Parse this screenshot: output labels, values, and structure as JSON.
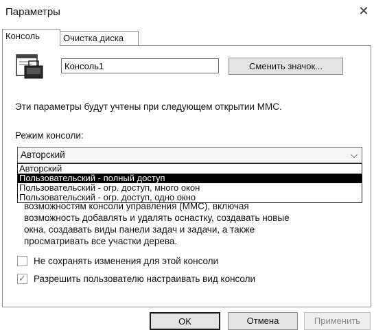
{
  "window": {
    "title": "Параметры",
    "close_glyph": "✕"
  },
  "tabs": [
    {
      "label": "Консоль",
      "active": true
    },
    {
      "label": "Очистка диска",
      "active": false
    }
  ],
  "console": {
    "name_value": "Консоль1",
    "change_icon_label": "Сменить значок...",
    "hint": "Эти параметры будут учтены при следующем открытии MMC.",
    "mode_label": "Режим консоли:",
    "mode_selected": "Авторский",
    "mode_options": [
      "Авторский",
      "Пользовательский - полный доступ",
      "Пользовательский - огр. доступ, много окон",
      "Пользовательский - огр. доступ, одно окно"
    ],
    "highlighted_option_index": 1,
    "description_lines": [
      "возможностям консоли управления (MMC), включая",
      "возможность добавлять и удалять оснастку, создавать новые",
      "окна, создавать виды панели задач и задачи, а также",
      "просматривать все участки дерева."
    ],
    "checkbox_no_save": {
      "label": "Не сохранять изменения для этой консоли",
      "checked": false
    },
    "checkbox_allow_view": {
      "label": "Разрешить пользователю настраивать вид консоли",
      "checked": true
    }
  },
  "buttons": {
    "ok": "OK",
    "cancel": "Отмена",
    "apply": "Применить"
  },
  "icons": {
    "console_icon": "mmc-console-icon",
    "chevron": "chevron-down-icon"
  }
}
